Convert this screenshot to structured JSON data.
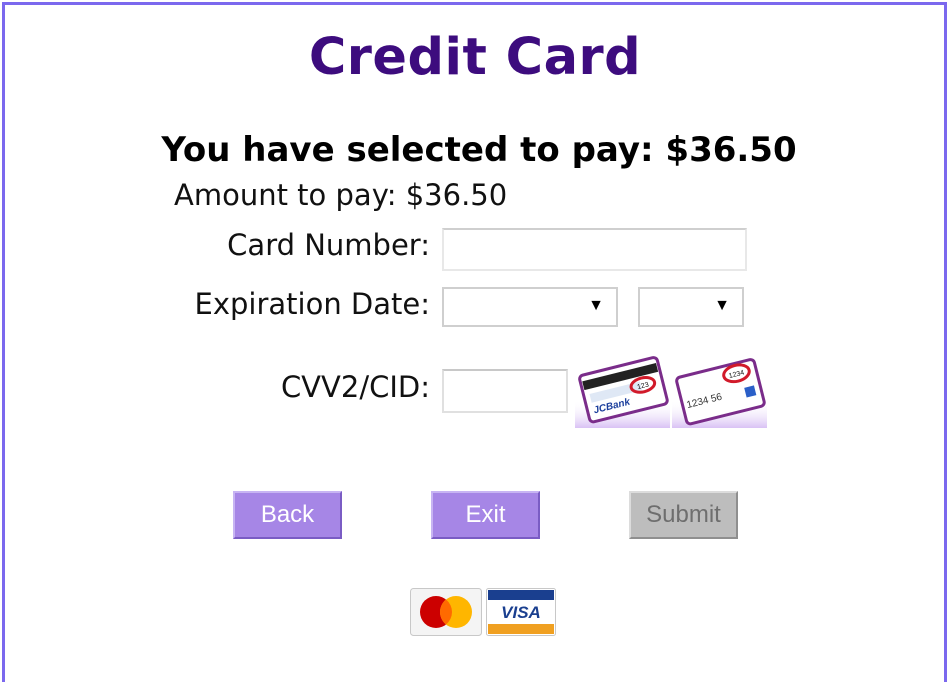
{
  "header": {
    "title": "Credit Card",
    "selection_text": "You have selected to pay: $36.50"
  },
  "form": {
    "amount_label": "Amount to pay: $36.50",
    "card_number_label": "Card Number:",
    "card_number_value": "",
    "expiration_label": "Expiration Date:",
    "expiration_month_value": "",
    "expiration_year_value": "",
    "cvv_label": "CVV2/CID:",
    "cvv_value": ""
  },
  "cvv_images": [
    {
      "icon": "card-back-cvv-icon",
      "text": "JCBank",
      "code": "123"
    },
    {
      "icon": "card-front-cid-icon",
      "text": "1234 56",
      "code": "1234"
    }
  ],
  "buttons": {
    "back": "Back",
    "exit": "Exit",
    "submit": "Submit"
  },
  "accepted_cards": {
    "mastercard_icon": "mastercard-logo-icon",
    "visa_label": "VISA"
  },
  "colors": {
    "title": "#3d0c7e",
    "frame_border": "#7b68ee",
    "button_purple": "#a686e6",
    "button_disabled": "#bdbdbd"
  }
}
